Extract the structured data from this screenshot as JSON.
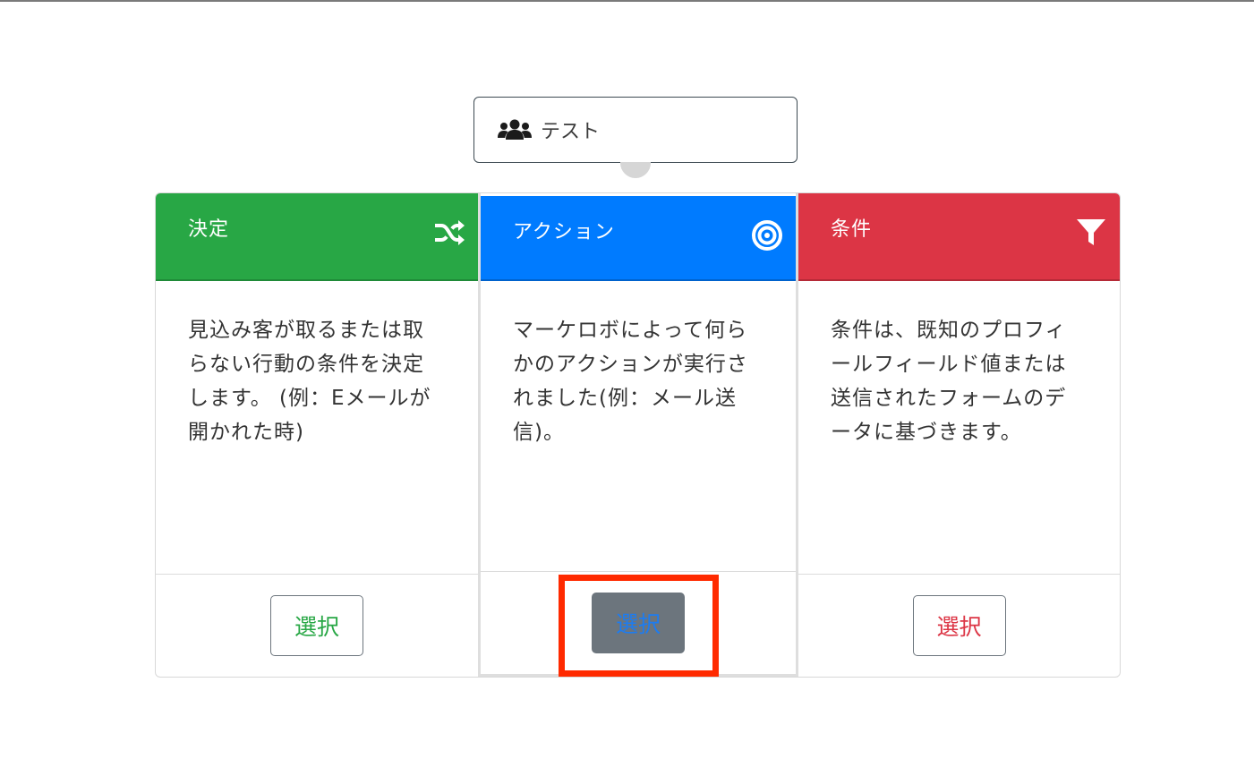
{
  "source": {
    "label": "テスト",
    "icon": "users-icon"
  },
  "cards": [
    {
      "title": "決定",
      "icon": "shuffle-icon",
      "color": "#28a745",
      "description_lines": [
        "見込み客が取るまたは取",
        "らない行動の条件を決定",
        "します。 (例：Eメールが",
        "開かれた時)"
      ],
      "button_label": "選択"
    },
    {
      "title": "アクション",
      "icon": "bullseye-icon",
      "color": "#007bff",
      "description_lines": [
        "マーケロボによって何ら",
        "かのアクションが実行さ",
        "れました(例：メール送",
        "信)。"
      ],
      "button_label": "選択"
    },
    {
      "title": "条件",
      "icon": "filter-icon",
      "color": "#dc3545",
      "description_lines": [
        "条件は、既知のプロフィ",
        "ールフィールド値または",
        "送信されたフォームのデ",
        "ータに基づきます。"
      ],
      "button_label": "選択"
    }
  ]
}
